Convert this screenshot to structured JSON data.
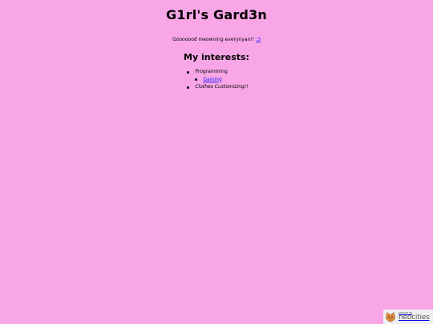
{
  "header": {
    "title": "G1rl's Gard3n"
  },
  "greeting": {
    "text": "Gooooood meowning everynyan!!",
    "emote_link": ":3"
  },
  "interests": {
    "heading": "My interests:",
    "items": [
      {
        "label": "Programming"
      },
      {
        "label": "Gaming",
        "nested": true,
        "link": true
      },
      {
        "label": "Clothes Customizing!!"
      }
    ]
  },
  "badge": {
    "small_text": "hosted by",
    "brand": "neocities",
    "icon": "neocities-cat-icon"
  },
  "colors": {
    "background": "#f8a6e6",
    "link": "#1a1aff",
    "text": "#000000"
  }
}
